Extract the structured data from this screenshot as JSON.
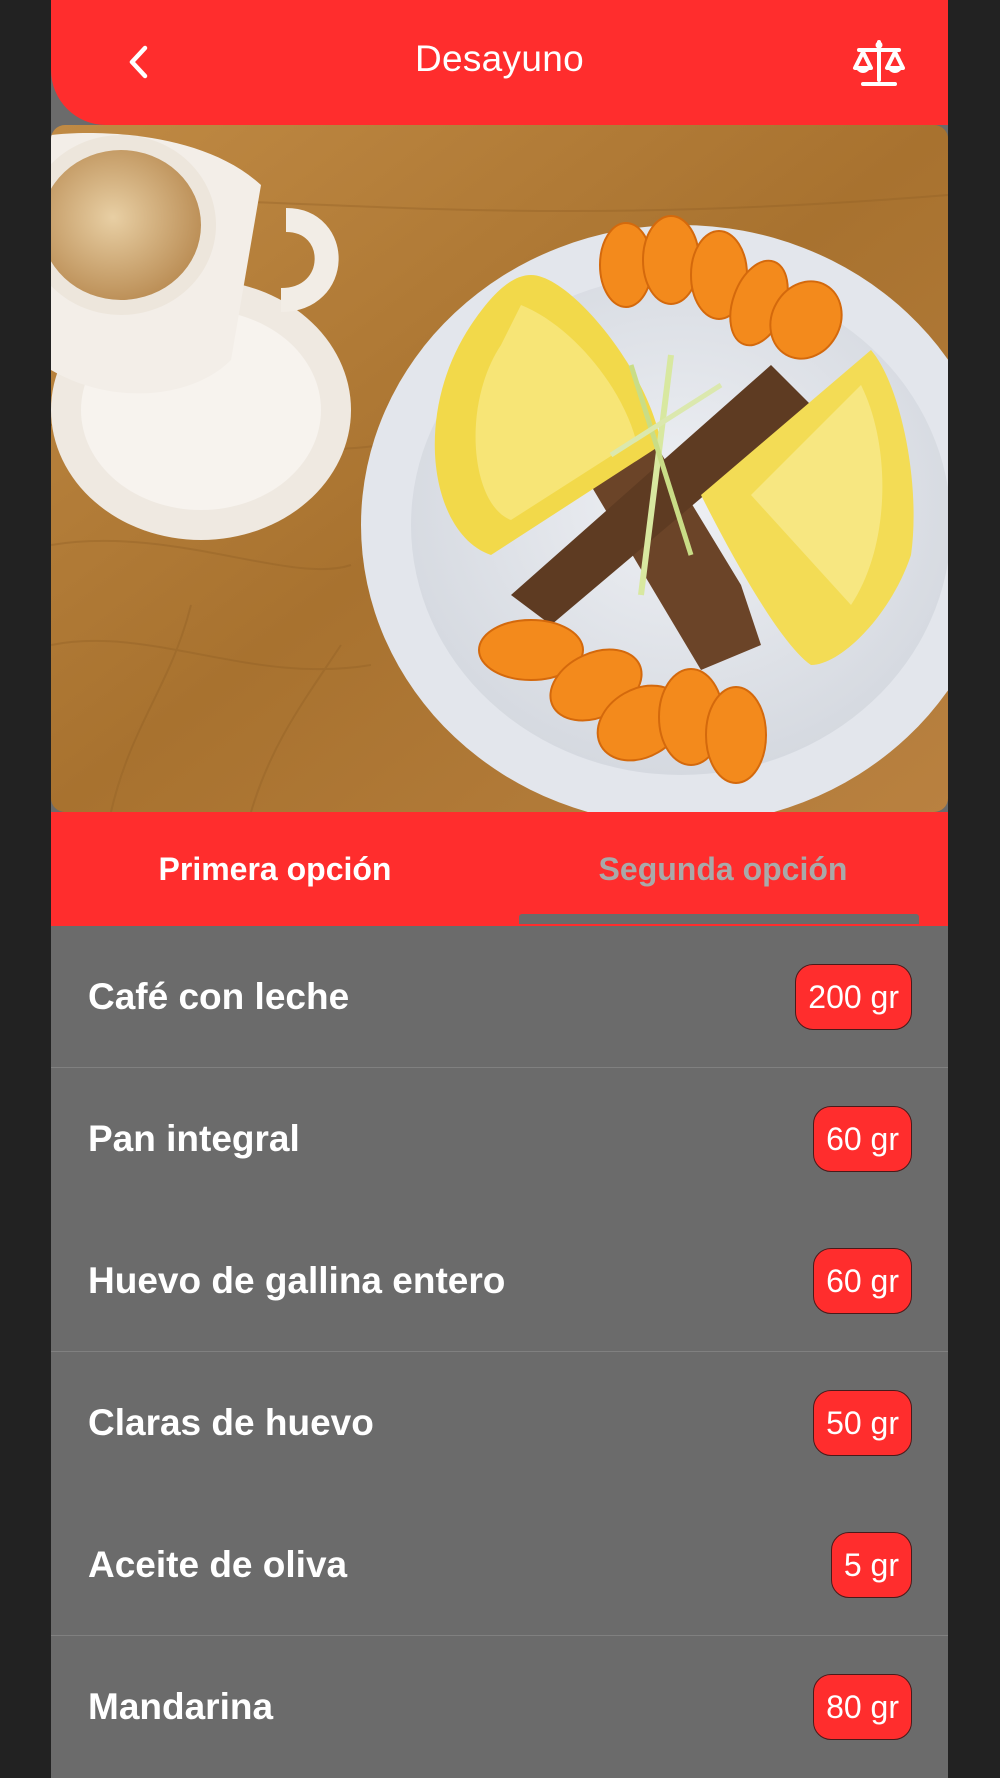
{
  "header": {
    "title": "Desayuno",
    "back_icon": "chevron-left-icon",
    "scale_icon": "balance-scale-icon"
  },
  "tabs": [
    {
      "label": "Primera opción",
      "selected": false
    },
    {
      "label": "Segunda opción",
      "selected": true
    }
  ],
  "items": [
    {
      "name": "Café con leche",
      "qty": "200 gr"
    },
    {
      "name": "Pan integral",
      "qty": "60 gr"
    },
    {
      "name": "Huevo de gallina entero",
      "qty": "60 gr"
    },
    {
      "name": "Claras de huevo",
      "qty": "50 gr"
    },
    {
      "name": "Aceite de oliva",
      "qty": "5 gr"
    },
    {
      "name": "Mandarina",
      "qty": "80 gr"
    }
  ],
  "colors": {
    "accent": "#ff2d2d",
    "list_bg": "#6b6b6b",
    "inactive_tab": "#a9a9a9"
  }
}
